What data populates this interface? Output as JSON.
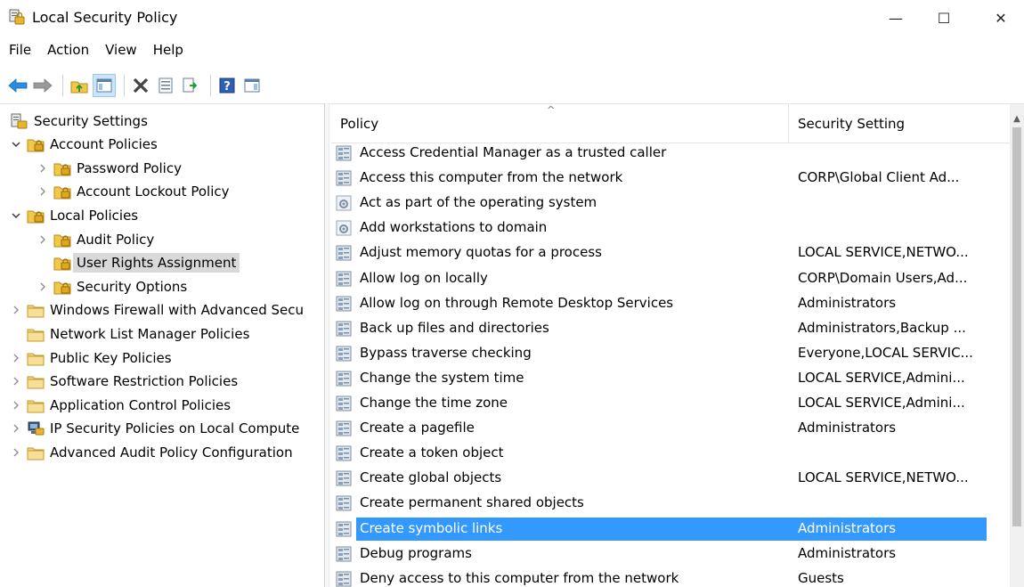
{
  "window": {
    "title": "Local Security Policy",
    "minimize_glyph": "—",
    "maximize_glyph": "☐",
    "close_glyph": "✕"
  },
  "menu": [
    "File",
    "Action",
    "View",
    "Help"
  ],
  "toolbar": {
    "buttons": [
      "back-arrow-icon",
      "forward-arrow-icon",
      "up-folder-icon",
      "show-hide-tree-icon",
      "delete-icon",
      "properties-icon",
      "export-list-icon",
      "help-icon",
      "show-hide-action-pane-icon"
    ]
  },
  "colors": {
    "selection": "#3399ff",
    "tree_selection": "#d9d9d9",
    "folder": "#f2c84b",
    "policy_icon": "#8aa0b8"
  },
  "tree": {
    "items": [
      {
        "label": "Security Settings",
        "level": 0,
        "expander": "none",
        "icon": "security-settings-icon"
      },
      {
        "label": "Account Policies",
        "level": 1,
        "expander": "expanded",
        "icon": "lock-folder-icon"
      },
      {
        "label": "Password Policy",
        "level": 2,
        "expander": "collapsed",
        "icon": "lock-folder-icon"
      },
      {
        "label": "Account Lockout Policy",
        "level": 2,
        "expander": "collapsed",
        "icon": "lock-folder-icon"
      },
      {
        "label": "Local Policies",
        "level": 1,
        "expander": "expanded",
        "icon": "lock-folder-icon"
      },
      {
        "label": "Audit Policy",
        "level": 2,
        "expander": "collapsed",
        "icon": "lock-folder-icon"
      },
      {
        "label": "User Rights Assignment",
        "level": 2,
        "expander": "none",
        "icon": "lock-folder-icon",
        "selected": true
      },
      {
        "label": "Security Options",
        "level": 2,
        "expander": "collapsed",
        "icon": "lock-folder-icon"
      },
      {
        "label": "Windows Firewall with Advanced Secu",
        "level": 1,
        "expander": "collapsed",
        "icon": "folder-icon"
      },
      {
        "label": "Network List Manager Policies",
        "level": 1,
        "expander": "none",
        "icon": "folder-icon"
      },
      {
        "label": "Public Key Policies",
        "level": 1,
        "expander": "collapsed",
        "icon": "folder-icon"
      },
      {
        "label": "Software Restriction Policies",
        "level": 1,
        "expander": "collapsed",
        "icon": "folder-icon"
      },
      {
        "label": "Application Control Policies",
        "level": 1,
        "expander": "collapsed",
        "icon": "folder-icon"
      },
      {
        "label": "IP Security Policies on Local Compute",
        "level": 1,
        "expander": "collapsed",
        "icon": "ip-security-icon"
      },
      {
        "label": "Advanced Audit Policy Configuration",
        "level": 1,
        "expander": "collapsed",
        "icon": "folder-icon"
      }
    ]
  },
  "list": {
    "columns": {
      "policy": "Policy",
      "setting": "Security Setting"
    },
    "sort_glyph": "^",
    "rows": [
      {
        "policy": "Access Credential Manager as a trusted caller",
        "setting": "",
        "icon": "policy-icon"
      },
      {
        "policy": "Access this computer from the network",
        "setting": "CORP\\Global Client Ad...",
        "icon": "policy-icon"
      },
      {
        "policy": "Act as part of the operating system",
        "setting": "",
        "icon": "policy-gear-icon"
      },
      {
        "policy": "Add workstations to domain",
        "setting": "",
        "icon": "policy-gear-icon"
      },
      {
        "policy": "Adjust memory quotas for a process",
        "setting": "LOCAL SERVICE,NETWO...",
        "icon": "policy-icon"
      },
      {
        "policy": "Allow log on locally",
        "setting": "CORP\\Domain Users,Ad...",
        "icon": "policy-icon"
      },
      {
        "policy": "Allow log on through Remote Desktop Services",
        "setting": "Administrators",
        "icon": "policy-icon"
      },
      {
        "policy": "Back up files and directories",
        "setting": "Administrators,Backup ...",
        "icon": "policy-icon"
      },
      {
        "policy": "Bypass traverse checking",
        "setting": "Everyone,LOCAL SERVIC...",
        "icon": "policy-icon"
      },
      {
        "policy": "Change the system time",
        "setting": "LOCAL SERVICE,Admini...",
        "icon": "policy-icon"
      },
      {
        "policy": "Change the time zone",
        "setting": "LOCAL SERVICE,Admini...",
        "icon": "policy-icon"
      },
      {
        "policy": "Create a pagefile",
        "setting": "Administrators",
        "icon": "policy-icon"
      },
      {
        "policy": "Create a token object",
        "setting": "",
        "icon": "policy-icon"
      },
      {
        "policy": "Create global objects",
        "setting": "LOCAL SERVICE,NETWO...",
        "icon": "policy-icon"
      },
      {
        "policy": "Create permanent shared objects",
        "setting": "",
        "icon": "policy-icon"
      },
      {
        "policy": "Create symbolic links",
        "setting": "Administrators",
        "icon": "policy-icon",
        "selected": true
      },
      {
        "policy": "Debug programs",
        "setting": "Administrators",
        "icon": "policy-icon"
      },
      {
        "policy": "Deny access to this computer from the network",
        "setting": "Guests",
        "icon": "policy-icon"
      }
    ]
  }
}
